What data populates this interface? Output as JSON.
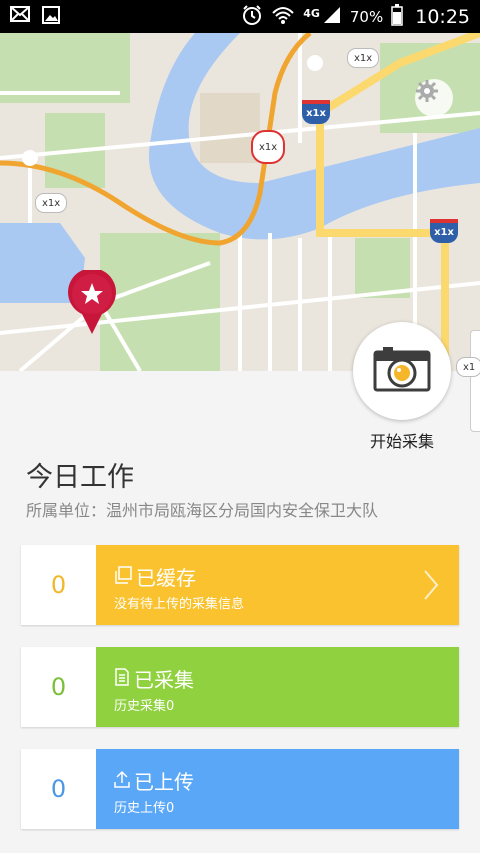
{
  "status_bar": {
    "network": "4G",
    "battery": "70%",
    "time": "10:25",
    "icons": [
      "mail-icon",
      "image-icon",
      "alarm-icon",
      "wifi-icon",
      "signal-icon",
      "battery-icon"
    ]
  },
  "map": {
    "route_labels": [
      "x1x",
      "x1x",
      "x1x",
      "x1x",
      "x1x",
      "x1"
    ],
    "colors": {
      "water": "#a9c9f2",
      "park": "#c6dfb0",
      "road_orange": "#f0a531",
      "road_yellow": "#fbd96e"
    }
  },
  "camera": {
    "label": "开始采集"
  },
  "work": {
    "title": "今日工作",
    "unit": "所属单位：温州市局瓯海区分局国内安全保卫大队"
  },
  "cards": [
    {
      "count": "0",
      "title": "已缓存",
      "subtitle": "没有待上传的采集信息",
      "color": "#f9c22e",
      "count_color": "#f1b82a"
    },
    {
      "count": "0",
      "title": "已采集",
      "subtitle": "历史采集0",
      "color": "#8fd13f",
      "count_color": "#7cbf3a"
    },
    {
      "count": "0",
      "title": "已上传",
      "subtitle": "历史上传0",
      "color": "#5aa7f7",
      "count_color": "#4b97e3"
    }
  ]
}
